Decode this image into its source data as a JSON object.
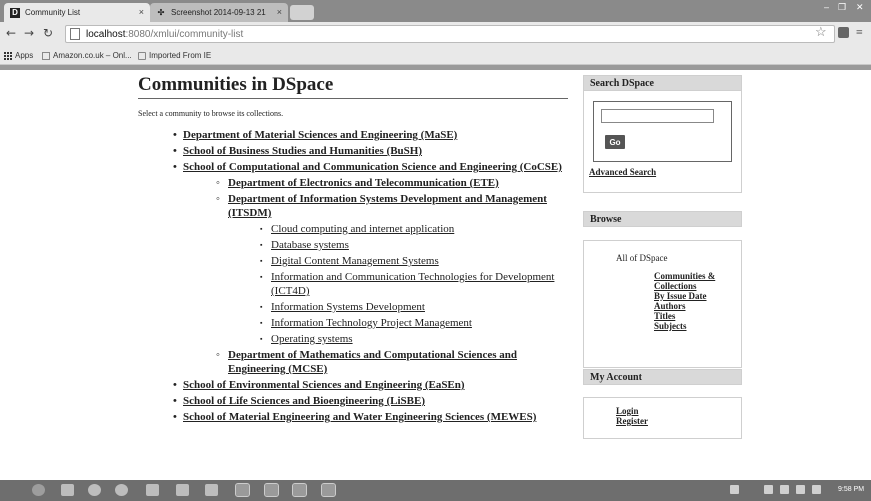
{
  "browser": {
    "tabs": [
      {
        "favicon": "D",
        "title": "Community List",
        "active": true
      },
      {
        "favicon": "✣",
        "title": "Screenshot 2014-09-13 21",
        "active": false
      }
    ],
    "address": {
      "host": "localhost",
      "path": ":8080/xmlui/community-list"
    },
    "bookmarks": [
      {
        "label": "Apps"
      },
      {
        "label": "Amazon.co.uk – Onl..."
      },
      {
        "label": "Imported From IE"
      }
    ]
  },
  "main": {
    "title": "Communities in DSpace",
    "intro": "Select a community to browse its collections.",
    "communities": [
      {
        "label": "Department of Material Sciences and Engineering (MaSE)"
      },
      {
        "label": "School of Business Studies and Humanities (BuSH)"
      },
      {
        "label": "School of Computational and Communication Science and Engineering (CoCSE)"
      },
      {
        "label": "Department of Electronics and Telecommunication (ETE)"
      },
      {
        "label": "Department of Information Systems Development and Management (ITSDM)"
      },
      {
        "label": "Cloud computing and internet application"
      },
      {
        "label": "Database systems"
      },
      {
        "label": "Digital Content Management Systems"
      },
      {
        "label": "Information and Communication Technologies for Development (ICT4D)"
      },
      {
        "label": "Information Systems Development"
      },
      {
        "label": "Information Technology Project Management"
      },
      {
        "label": "Operating systems"
      },
      {
        "label": "Department of Mathematics and Computational Sciences and Engineering (MCSE)"
      },
      {
        "label": "School of Environmental Sciences and Engineering (EaSEn)"
      },
      {
        "label": "School of Life Sciences and Bioengineering (LiSBE)"
      },
      {
        "label": "School of Material Engineering and Water Engineering Sciences (MEWES)"
      }
    ]
  },
  "sidebar": {
    "search_title": "Search DSpace",
    "go_label": "Go",
    "advanced_label": "Advanced Search",
    "browse_title": "Browse",
    "browse_all": "All of DSpace",
    "browse_links": [
      "Communities & Collections",
      "By Issue Date",
      "Authors",
      "Titles",
      "Subjects"
    ],
    "account_title": "My Account",
    "account_links": [
      "Login",
      "Register"
    ]
  },
  "taskbar": {
    "clock": "9:58 PM"
  }
}
